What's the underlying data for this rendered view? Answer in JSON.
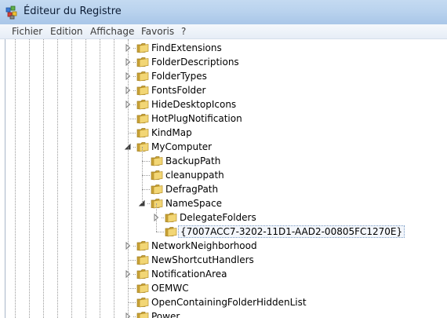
{
  "window": {
    "title": "Éditeur du Registre"
  },
  "menu": {
    "items": [
      "Fichier",
      "Edition",
      "Affichage",
      "Favoris",
      "?"
    ]
  },
  "tree": {
    "nodes": [
      {
        "label": "FindExtensions",
        "level": 0,
        "state": "collapsed"
      },
      {
        "label": "FolderDescriptions",
        "level": 0,
        "state": "collapsed"
      },
      {
        "label": "FolderTypes",
        "level": 0,
        "state": "collapsed"
      },
      {
        "label": "FontsFolder",
        "level": 0,
        "state": "collapsed"
      },
      {
        "label": "HideDesktopIcons",
        "level": 0,
        "state": "collapsed"
      },
      {
        "label": "HotPlugNotification",
        "level": 0,
        "state": "leaf"
      },
      {
        "label": "KindMap",
        "level": 0,
        "state": "leaf"
      },
      {
        "label": "MyComputer",
        "level": 0,
        "state": "expanded"
      },
      {
        "label": "BackupPath",
        "level": 1,
        "state": "leaf"
      },
      {
        "label": "cleanuppath",
        "level": 1,
        "state": "leaf"
      },
      {
        "label": "DefragPath",
        "level": 1,
        "state": "leaf"
      },
      {
        "label": "NameSpace",
        "level": 1,
        "state": "expanded"
      },
      {
        "label": "DelegateFolders",
        "level": 2,
        "state": "collapsed"
      },
      {
        "label": "{7007ACC7-3202-11D1-AAD2-00805FC1270E}",
        "level": 2,
        "state": "leaf",
        "selected": true
      },
      {
        "label": "NetworkNeighborhood",
        "level": 0,
        "state": "collapsed"
      },
      {
        "label": "NewShortcutHandlers",
        "level": 0,
        "state": "leaf"
      },
      {
        "label": "NotificationArea",
        "level": 0,
        "state": "collapsed"
      },
      {
        "label": "OEMWC",
        "level": 0,
        "state": "leaf"
      },
      {
        "label": "OpenContainingFolderHiddenList",
        "level": 0,
        "state": "leaf"
      },
      {
        "label": "Power",
        "level": 0,
        "state": "collapsed"
      }
    ]
  },
  "colors": {
    "titlebar": "#bad3ee",
    "folder": "#e8c34a",
    "selection_border": "#7a9cc6"
  },
  "icons": {
    "app": "regedit-icon",
    "folder": "folder-icon",
    "collapsed": "triangle-right-icon",
    "expanded": "triangle-down-icon"
  }
}
